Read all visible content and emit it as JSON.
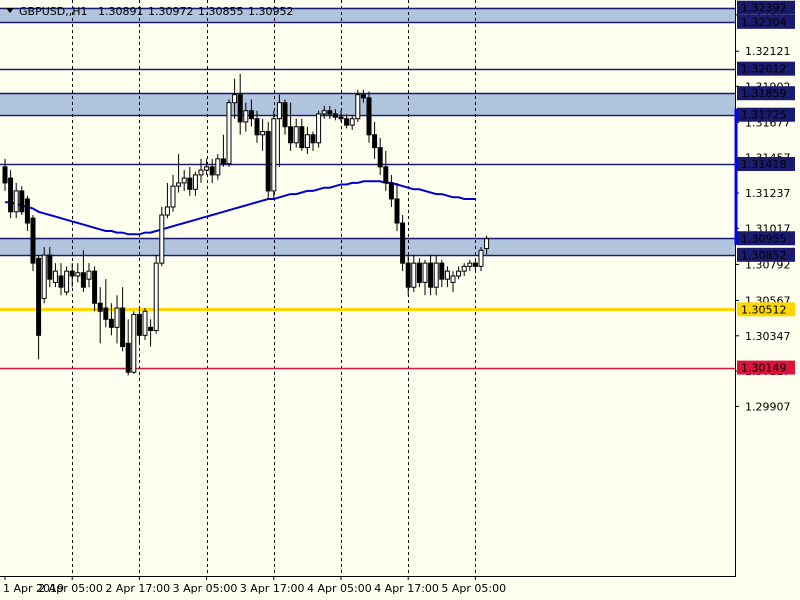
{
  "chart_data": {
    "type": "candlestick",
    "symbol": "GBPUSD,,H1",
    "ohlc_readout": [
      "1.30891",
      "1.30972",
      "1.30855",
      "1.30952"
    ],
    "ylim": [
      1.2885,
      1.3244
    ],
    "y_ticks": [
      "1.32347",
      "1.32121",
      "1.31902",
      "1.31677",
      "1.31457",
      "1.31237",
      "1.31017",
      "1.30792",
      "1.30567",
      "1.30347",
      "1.30127",
      "1.29907"
    ],
    "x_ticks": [
      "1 Apr 2019",
      "2 Apr 05:00",
      "2 Apr 17:00",
      "3 Apr 05:00",
      "3 Apr 17:00",
      "4 Apr 05:00",
      "4 Apr 17:00",
      "5 Apr 05:00"
    ],
    "x_tick_bars": [
      0,
      12,
      24,
      36,
      48,
      60,
      72,
      84
    ],
    "levels": [
      {
        "label": "1.32392",
        "value": 1.32392,
        "color": "#1a1a6e"
      },
      {
        "label": "1.32304",
        "value": 1.32304,
        "color": "#1a1a6e"
      },
      {
        "label": "1.32012",
        "value": 1.32012,
        "color": "#1a1a6e"
      },
      {
        "label": "1.31859",
        "value": 1.31859,
        "color": "#1a1a6e"
      },
      {
        "label": "1.31725",
        "value": 1.31725,
        "color": "#1a1a6e"
      },
      {
        "label": "1.31418",
        "value": 1.31418,
        "color": "#1a1a6e"
      },
      {
        "label": "1.30955",
        "value": 1.30955,
        "color": "#1a1a6e"
      },
      {
        "label": "1.30852",
        "value": 1.30852,
        "color": "#1a1a6e"
      },
      {
        "label": "1.30512",
        "value": 1.30512,
        "color": "#ffd700"
      },
      {
        "label": "1.30149",
        "value": 1.30149,
        "color": "#dc143c"
      }
    ],
    "zones": [
      [
        1.32304,
        1.32392
      ],
      [
        1.31725,
        1.31859
      ],
      [
        1.30852,
        1.30955
      ]
    ],
    "current_price": 1.30952,
    "candles": [
      [
        1.314,
        1.3145,
        1.3125,
        1.313
      ],
      [
        1.3133,
        1.3138,
        1.3108,
        1.3112
      ],
      [
        1.3112,
        1.313,
        1.3108,
        1.3125
      ],
      [
        1.3125,
        1.3128,
        1.311,
        1.3112
      ],
      [
        1.312,
        1.3122,
        1.31,
        1.3105
      ],
      [
        1.3108,
        1.311,
        1.3075,
        1.308
      ],
      [
        1.3083,
        1.3085,
        1.302,
        1.3035
      ],
      [
        1.3058,
        1.309,
        1.3055,
        1.3085
      ],
      [
        1.3085,
        1.309,
        1.3065,
        1.307
      ],
      [
        1.3068,
        1.308,
        1.3065,
        1.3075
      ],
      [
        1.3072,
        1.308,
        1.306,
        1.3065
      ],
      [
        1.3062,
        1.3078,
        1.306,
        1.3075
      ],
      [
        1.3075,
        1.308,
        1.3065,
        1.3072
      ],
      [
        1.3072,
        1.308,
        1.3068,
        1.3074
      ],
      [
        1.3074,
        1.3088,
        1.3062,
        1.3065
      ],
      [
        1.307,
        1.308,
        1.3065,
        1.3075
      ],
      [
        1.3075,
        1.3078,
        1.305,
        1.3055
      ],
      [
        1.3055,
        1.3065,
        1.303,
        1.305
      ],
      [
        1.3052,
        1.307,
        1.304,
        1.3045
      ],
      [
        1.3045,
        1.3055,
        1.3035,
        1.304
      ],
      [
        1.304,
        1.306,
        1.303,
        1.3052
      ],
      [
        1.3052,
        1.3065,
        1.3025,
        1.3028
      ],
      [
        1.303,
        1.3045,
        1.301,
        1.3012
      ],
      [
        1.3012,
        1.305,
        1.3011,
        1.3048
      ],
      [
        1.3048,
        1.3052,
        1.303,
        1.3035
      ],
      [
        1.3035,
        1.3052,
        1.3032,
        1.305
      ],
      [
        1.304,
        1.3045,
        1.3028,
        1.3038
      ],
      [
        1.3038,
        1.3085,
        1.3036,
        1.308
      ],
      [
        1.308,
        1.3115,
        1.3078,
        1.311
      ],
      [
        1.311,
        1.313,
        1.3108,
        1.3115
      ],
      [
        1.3115,
        1.3135,
        1.3112,
        1.3128
      ],
      [
        1.3128,
        1.3148,
        1.3124,
        1.313
      ],
      [
        1.313,
        1.3138,
        1.3125,
        1.3133
      ],
      [
        1.3133,
        1.314,
        1.3122,
        1.3126
      ],
      [
        1.3126,
        1.3137,
        1.3122,
        1.3135
      ],
      [
        1.3135,
        1.3145,
        1.313,
        1.3138
      ],
      [
        1.3138,
        1.3145,
        1.3135,
        1.314
      ],
      [
        1.314,
        1.3145,
        1.313,
        1.3135
      ],
      [
        1.3135,
        1.3148,
        1.3132,
        1.3145
      ],
      [
        1.3145,
        1.316,
        1.314,
        1.3142
      ],
      [
        1.3142,
        1.3182,
        1.314,
        1.318
      ],
      [
        1.318,
        1.3195,
        1.317,
        1.3185
      ],
      [
        1.3185,
        1.3198,
        1.316,
        1.3168
      ],
      [
        1.3168,
        1.318,
        1.3162,
        1.3175
      ],
      [
        1.3175,
        1.3182,
        1.3165,
        1.317
      ],
      [
        1.317,
        1.3175,
        1.3155,
        1.316
      ],
      [
        1.316,
        1.317,
        1.315,
        1.3162
      ],
      [
        1.3162,
        1.3168,
        1.312,
        1.3125
      ],
      [
        1.3125,
        1.3175,
        1.312,
        1.317
      ],
      [
        1.317,
        1.3185,
        1.314,
        1.318
      ],
      [
        1.318,
        1.3182,
        1.316,
        1.3165
      ],
      [
        1.3165,
        1.318,
        1.315,
        1.3155
      ],
      [
        1.3155,
        1.317,
        1.3152,
        1.3165
      ],
      [
        1.3165,
        1.317,
        1.315,
        1.3152
      ],
      [
        1.3152,
        1.3165,
        1.3148,
        1.316
      ],
      [
        1.316,
        1.3162,
        1.315,
        1.3155
      ],
      [
        1.3155,
        1.3175,
        1.3152,
        1.3173
      ],
      [
        1.3173,
        1.3178,
        1.317,
        1.3175
      ],
      [
        1.3175,
        1.3178,
        1.317,
        1.3173
      ],
      [
        1.3173,
        1.3176,
        1.3169,
        1.3171
      ],
      [
        1.3171,
        1.3175,
        1.3168,
        1.317
      ],
      [
        1.317,
        1.3173,
        1.3164,
        1.3166
      ],
      [
        1.3166,
        1.3172,
        1.3163,
        1.317
      ],
      [
        1.317,
        1.3188,
        1.3168,
        1.3185
      ],
      [
        1.3185,
        1.3188,
        1.318,
        1.3183
      ],
      [
        1.3183,
        1.3187,
        1.3155,
        1.316
      ],
      [
        1.316,
        1.3168,
        1.3145,
        1.3152
      ],
      [
        1.3152,
        1.3158,
        1.3135,
        1.314
      ],
      [
        1.314,
        1.315,
        1.3125,
        1.313
      ],
      [
        1.313,
        1.3135,
        1.3115,
        1.312
      ],
      [
        1.312,
        1.313,
        1.31,
        1.3105
      ],
      [
        1.3105,
        1.311,
        1.3075,
        1.308
      ],
      [
        1.308,
        1.3085,
        1.306,
        1.3065
      ],
      [
        1.3065,
        1.3085,
        1.3062,
        1.308
      ],
      [
        1.308,
        1.3083,
        1.3065,
        1.3068
      ],
      [
        1.3068,
        1.3082,
        1.306,
        1.308
      ],
      [
        1.308,
        1.3085,
        1.306,
        1.3065
      ],
      [
        1.3065,
        1.3085,
        1.306,
        1.308
      ],
      [
        1.308,
        1.3082,
        1.3065,
        1.307
      ],
      [
        1.307,
        1.3078,
        1.3065,
        1.3075
      ],
      [
        1.3068,
        1.3075,
        1.3062,
        1.3072
      ],
      [
        1.3072,
        1.3078,
        1.307,
        1.3075
      ],
      [
        1.3075,
        1.308,
        1.3072,
        1.3078
      ],
      [
        1.3078,
        1.3082,
        1.3075,
        1.308
      ],
      [
        1.308,
        1.3083,
        1.3075,
        1.3078
      ],
      [
        1.3078,
        1.309,
        1.3075,
        1.3088
      ],
      [
        1.30891,
        1.30972,
        1.30855,
        1.30952
      ]
    ],
    "ma": [
      1.3118,
      1.3118,
      1.3117,
      1.3116,
      1.3115,
      1.3114,
      1.3112,
      1.3111,
      1.311,
      1.3109,
      1.3108,
      1.3107,
      1.3106,
      1.3105,
      1.3104,
      1.3103,
      1.3102,
      1.3101,
      1.31,
      1.31,
      1.3099,
      1.3099,
      1.3098,
      1.3098,
      1.3098,
      1.3099,
      1.3099,
      1.31,
      1.3101,
      1.3102,
      1.3103,
      1.3104,
      1.3105,
      1.3106,
      1.3107,
      1.3108,
      1.3109,
      1.311,
      1.3111,
      1.3112,
      1.3113,
      1.3114,
      1.3115,
      1.3116,
      1.3117,
      1.3118,
      1.3119,
      1.312,
      1.312,
      1.3121,
      1.3122,
      1.3123,
      1.3123,
      1.3124,
      1.3125,
      1.3125,
      1.3126,
      1.3127,
      1.3127,
      1.3128,
      1.3129,
      1.3129,
      1.313,
      1.313,
      1.3131,
      1.3131,
      1.3131,
      1.3131,
      1.313,
      1.313,
      1.3129,
      1.3128,
      1.3127,
      1.3126,
      1.3126,
      1.3125,
      1.3124,
      1.3123,
      1.3123,
      1.3122,
      1.3121,
      1.3121,
      1.312,
      1.312,
      1.312
    ],
    "colors": {
      "background": "#fffff0",
      "zone": "#b0c4de",
      "ma": "#0000cd",
      "bull": "#ffffff",
      "bear": "#000000",
      "price_line": "#cd853f"
    }
  }
}
